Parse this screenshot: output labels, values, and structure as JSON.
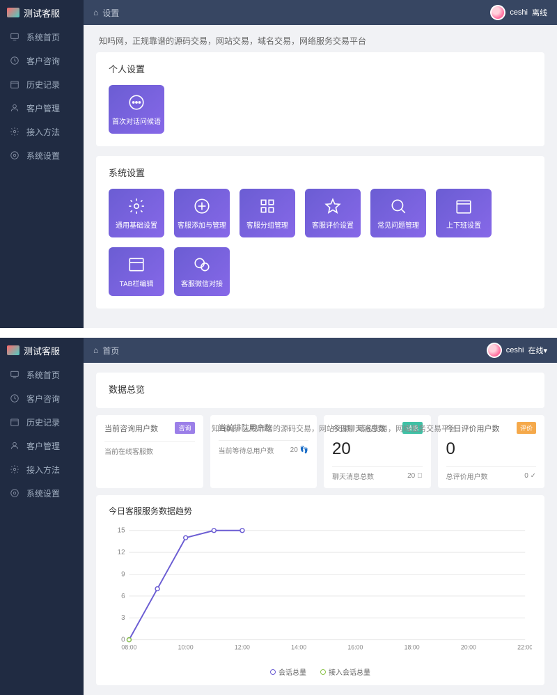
{
  "brand": "测试客服",
  "user": {
    "name": "ceshi",
    "status1": "离线",
    "status2": "在线▾"
  },
  "tagline": "知吗网，正规靠谱的源码交易，网站交易，域名交易，网络服务交易平台",
  "topbar1": {
    "home_icon": "⌂",
    "title": "设置"
  },
  "topbar2": {
    "home_icon": "⌂",
    "title": "首页"
  },
  "nav": [
    {
      "label": "系统首页",
      "icon": "monitor"
    },
    {
      "label": "客户咨询",
      "icon": "clock"
    },
    {
      "label": "历史记录",
      "icon": "calendar"
    },
    {
      "label": "客户管理",
      "icon": "user"
    },
    {
      "label": "接入方法",
      "icon": "gear"
    },
    {
      "label": "系统设置",
      "icon": "cog"
    }
  ],
  "section1": {
    "title": "个人设置",
    "tiles": [
      {
        "label": "首次对话问候语",
        "icon": "chat"
      }
    ]
  },
  "section2": {
    "title": "系统设置",
    "tiles_row1": [
      {
        "label": "通用基础设置",
        "icon": "gear"
      },
      {
        "label": "客服添加与管理",
        "icon": "plus"
      },
      {
        "label": "客服分组管理",
        "icon": "grid"
      },
      {
        "label": "客服评价设置",
        "icon": "star"
      },
      {
        "label": "常见问题管理",
        "icon": "search"
      },
      {
        "label": "上下班设置",
        "icon": "calendar2"
      }
    ],
    "tiles_row2": [
      {
        "label": "TAB栏编辑",
        "icon": "window"
      },
      {
        "label": "客服微信对接",
        "icon": "wechat"
      }
    ]
  },
  "dashboard": {
    "title": "数据总览",
    "stats": [
      {
        "label": "当前咨询用户数",
        "badge": "咨询",
        "badge_cls": "badge-purple",
        "value": "",
        "foot_label": "当前在线客服数",
        "foot_val": ""
      },
      {
        "label": "当前排队用户数",
        "badge": "",
        "badge_cls": "",
        "value": "",
        "foot_label": "当前等待总用户数",
        "foot_val": "20 👣"
      },
      {
        "label": "今日聊天消息数",
        "badge": "消息",
        "badge_cls": "badge-teal",
        "value": "20",
        "foot_label": "聊天消息总数",
        "foot_val": "20 ⃝"
      },
      {
        "label": "今日评价用户数",
        "badge": "评价",
        "badge_cls": "badge-orange",
        "value": "0",
        "foot_label": "总评价用户数",
        "foot_val": "0 ✓"
      }
    ],
    "chart_title": "今日客服服务数据趋势"
  },
  "chart_data": {
    "type": "line",
    "title": "今日客服服务数据趋势",
    "xlabel": "",
    "ylabel": "",
    "ylim": [
      0,
      15
    ],
    "y_ticks": [
      0,
      3,
      6,
      9,
      12,
      15
    ],
    "x_ticks": [
      "08:00",
      "10:00",
      "12:00",
      "14:00",
      "16:00",
      "18:00",
      "20:00",
      "22:00"
    ],
    "series": [
      {
        "name": "会话总量",
        "color": "#6b5dd3",
        "x": [
          "08:00",
          "09:00",
          "10:00",
          "11:00",
          "12:00"
        ],
        "values": [
          0,
          7,
          14,
          15,
          15
        ]
      },
      {
        "name": "接入会话总量",
        "color": "#8bc34a",
        "x": [
          "08:00"
        ],
        "values": [
          0
        ]
      }
    ],
    "legend": [
      {
        "label": "会话总量",
        "color": "#6b5dd3"
      },
      {
        "label": "接入会话总量",
        "color": "#8bc34a"
      }
    ]
  },
  "watermark_tagline": "知吗网，正规靠谱的源码交易，网站交易，域名交易，网络服务交易平台"
}
